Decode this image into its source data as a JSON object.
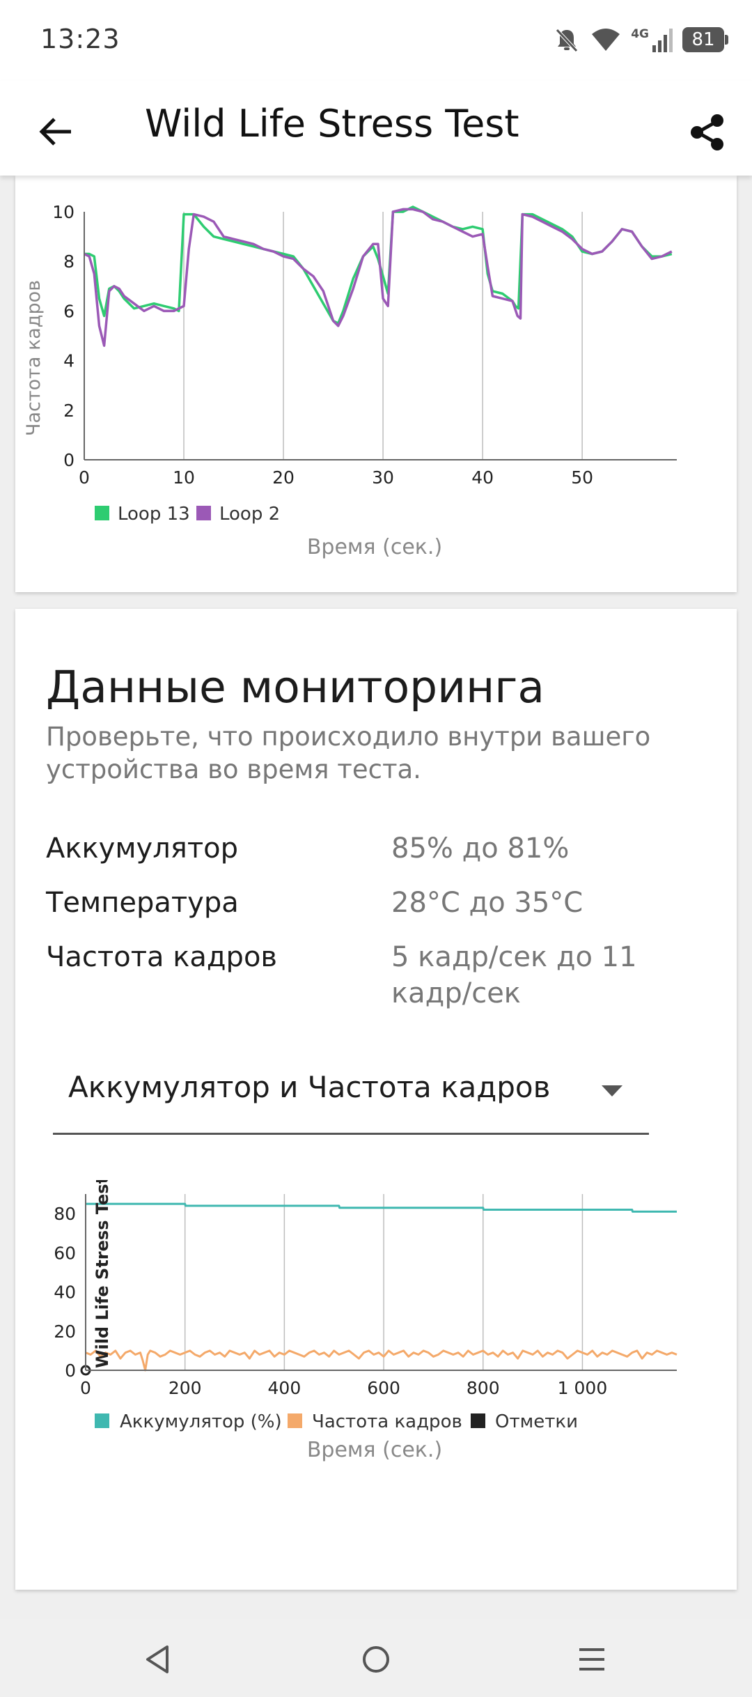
{
  "status_bar": {
    "time": "13:23",
    "battery": "81",
    "network": "4G"
  },
  "app_bar": {
    "title": "Wild Life Stress Test",
    "back_icon": "arrow-left-icon",
    "share_icon": "share-icon"
  },
  "fps_chart": {
    "chart_data": {
      "type": "line",
      "xlabel": "Время (сек.)",
      "ylabel": "Частота кадров",
      "xlim": [
        0,
        59.5
      ],
      "ylim": [
        0,
        10
      ],
      "xticks": [
        "0",
        "10",
        "20",
        "30",
        "40",
        "50"
      ],
      "yticks": [
        "0",
        "2",
        "4",
        "6",
        "8",
        "10"
      ],
      "grid": "vertical",
      "legend_position": "bottom-left",
      "series": [
        {
          "name": "Loop 13",
          "color": "#2ecc71",
          "x": [
            0,
            0.5,
            1,
            1.5,
            2,
            2.5,
            3,
            3.5,
            4,
            5,
            6,
            7,
            8,
            9,
            9.5,
            10,
            11,
            12,
            13,
            14,
            15,
            16,
            17,
            18,
            19,
            20,
            21,
            22,
            23,
            24,
            25,
            25.5,
            26,
            27,
            28,
            29,
            29.5,
            30,
            30.5,
            31,
            32,
            33,
            34,
            35,
            36,
            37,
            38,
            39,
            40,
            40.5,
            41,
            42,
            43,
            43.3,
            43.6,
            44,
            45,
            46,
            47,
            48,
            49,
            50,
            51,
            52,
            53,
            54,
            55,
            56,
            57,
            58,
            59
          ],
          "y": [
            8.3,
            8.3,
            8.2,
            6.5,
            5.8,
            6.9,
            7.0,
            6.8,
            6.5,
            6.1,
            6.2,
            6.3,
            6.2,
            6.1,
            6.0,
            9.9,
            9.9,
            9.4,
            9.0,
            8.9,
            8.8,
            8.7,
            8.6,
            8.5,
            8.4,
            8.3,
            8.2,
            7.7,
            7.0,
            6.3,
            5.6,
            5.5,
            6.0,
            7.3,
            8.2,
            8.6,
            8.1,
            7.4,
            6.7,
            10.0,
            10.0,
            10.2,
            10.0,
            9.8,
            9.6,
            9.4,
            9.3,
            9.4,
            9.3,
            7.5,
            6.8,
            6.7,
            6.4,
            6.2,
            6.1,
            9.9,
            9.9,
            9.7,
            9.5,
            9.3,
            9.0,
            8.4,
            8.3,
            8.4,
            8.8,
            9.3,
            9.2,
            8.6,
            8.2,
            8.2,
            8.3
          ]
        },
        {
          "name": "Loop 2",
          "color": "#9b59b6",
          "x": [
            0,
            0.5,
            1,
            1.5,
            2,
            2.5,
            3,
            3.5,
            4,
            5,
            6,
            7,
            8,
            9,
            10,
            10.5,
            11,
            12,
            13,
            14,
            15,
            16,
            17,
            18,
            19,
            20,
            21,
            22,
            23,
            24,
            25,
            25.5,
            26,
            27,
            28,
            29,
            29.5,
            30,
            30.5,
            31,
            32,
            33,
            34,
            35,
            36,
            37,
            38,
            39,
            40,
            40.5,
            41,
            42,
            43,
            43.5,
            43.8,
            44,
            45,
            46,
            47,
            48,
            49,
            50,
            51,
            52,
            53,
            54,
            55,
            56,
            57,
            58,
            59
          ],
          "y": [
            8.3,
            8.2,
            7.5,
            5.4,
            4.6,
            6.8,
            7.0,
            6.9,
            6.6,
            6.3,
            6.0,
            6.2,
            6.0,
            6.0,
            6.2,
            8.5,
            9.9,
            9.8,
            9.6,
            9.0,
            8.9,
            8.8,
            8.7,
            8.5,
            8.4,
            8.2,
            8.1,
            7.7,
            7.4,
            6.8,
            5.6,
            5.4,
            5.8,
            6.9,
            8.2,
            8.7,
            8.7,
            6.5,
            6.2,
            10.0,
            10.1,
            10.1,
            10.0,
            9.7,
            9.6,
            9.4,
            9.2,
            9.0,
            9.1,
            7.8,
            6.6,
            6.5,
            6.4,
            5.8,
            5.7,
            9.9,
            9.8,
            9.6,
            9.4,
            9.2,
            8.9,
            8.5,
            8.3,
            8.4,
            8.8,
            9.3,
            9.2,
            8.6,
            8.1,
            8.2,
            8.4
          ]
        }
      ]
    }
  },
  "monitoring": {
    "title": "Данные мониторинга",
    "subtitle": "Проверьте, что происходило внутри вашего устройства во время теста.",
    "rows": [
      {
        "label": "Аккумулятор",
        "value": "85% до 81%"
      },
      {
        "label": "Температура",
        "value": "28°C до 35°C"
      },
      {
        "label": "Частота кадров",
        "value": "5 кадр/сек до 11 кадр/сек"
      }
    ],
    "dropdown": {
      "selected": "Аккумулятор и Частота кадров"
    }
  },
  "monitor_chart": {
    "chart_data": {
      "type": "line",
      "xlabel": "Время (сек.)",
      "xlim": [
        0,
        1190
      ],
      "ylim": [
        0,
        90
      ],
      "xticks": [
        "0",
        "200",
        "400",
        "600",
        "800",
        "1 000"
      ],
      "yticks": [
        "0",
        "20",
        "40",
        "60",
        "80"
      ],
      "grid": "vertical",
      "legend_position": "bottom-left",
      "marker_label": "Wild Life Stress Test",
      "series": [
        {
          "name": "Аккумулятор (%)",
          "color": "#3fb8b0",
          "x": [
            0,
            200,
            201,
            510,
            511,
            800,
            801,
            1100,
            1101,
            1190
          ],
          "y": [
            85,
            85,
            84,
            84,
            83,
            83,
            82,
            82,
            81,
            81
          ]
        },
        {
          "name": "Частота кадров",
          "color": "#f4a96a",
          "x": [
            0,
            10,
            20,
            30,
            40,
            50,
            60,
            70,
            80,
            90,
            100,
            110,
            115,
            120,
            125,
            130,
            140,
            150,
            160,
            170,
            180,
            190,
            200,
            210,
            220,
            230,
            240,
            250,
            260,
            270,
            280,
            290,
            300,
            310,
            320,
            330,
            340,
            350,
            360,
            370,
            380,
            390,
            400,
            410,
            420,
            430,
            440,
            450,
            460,
            470,
            480,
            490,
            500,
            510,
            520,
            530,
            540,
            550,
            560,
            570,
            580,
            590,
            600,
            610,
            620,
            630,
            640,
            650,
            660,
            670,
            680,
            690,
            700,
            710,
            720,
            730,
            740,
            750,
            760,
            770,
            780,
            790,
            800,
            810,
            820,
            830,
            840,
            850,
            860,
            870,
            880,
            890,
            900,
            910,
            920,
            930,
            940,
            950,
            960,
            970,
            980,
            990,
            1000,
            1010,
            1020,
            1030,
            1040,
            1050,
            1060,
            1070,
            1080,
            1090,
            1100,
            1110,
            1120,
            1130,
            1140,
            1150,
            1160,
            1170,
            1180,
            1190
          ],
          "y": [
            9,
            8,
            10,
            7,
            9,
            8,
            10,
            6,
            9,
            10,
            8,
            9,
            5,
            0,
            8,
            10,
            9,
            7,
            8,
            10,
            9,
            8,
            9,
            10,
            8,
            7,
            9,
            10,
            8,
            9,
            7,
            10,
            9,
            8,
            9,
            6,
            10,
            8,
            9,
            10,
            7,
            9,
            8,
            10,
            9,
            8,
            7,
            9,
            10,
            8,
            9,
            7,
            10,
            8,
            9,
            10,
            8,
            6,
            9,
            10,
            8,
            9,
            7,
            10,
            8,
            9,
            10,
            7,
            9,
            8,
            10,
            9,
            7,
            8,
            10,
            9,
            8,
            9,
            7,
            10,
            8,
            9,
            10,
            8,
            9,
            7,
            10,
            8,
            9,
            6,
            10,
            9,
            8,
            10,
            7,
            9,
            8,
            10,
            9,
            6,
            8,
            10,
            9,
            8,
            10,
            7,
            9,
            8,
            10,
            9,
            8,
            7,
            9,
            10,
            6,
            9,
            8,
            10,
            9,
            8,
            9,
            8
          ]
        },
        {
          "name": "Отметки",
          "color": "#222222",
          "x": [
            0
          ],
          "y": [
            0
          ]
        }
      ]
    }
  },
  "nav": {
    "back_icon": "nav-back-icon",
    "home_icon": "nav-home-icon",
    "menu_icon": "nav-menu-icon"
  }
}
